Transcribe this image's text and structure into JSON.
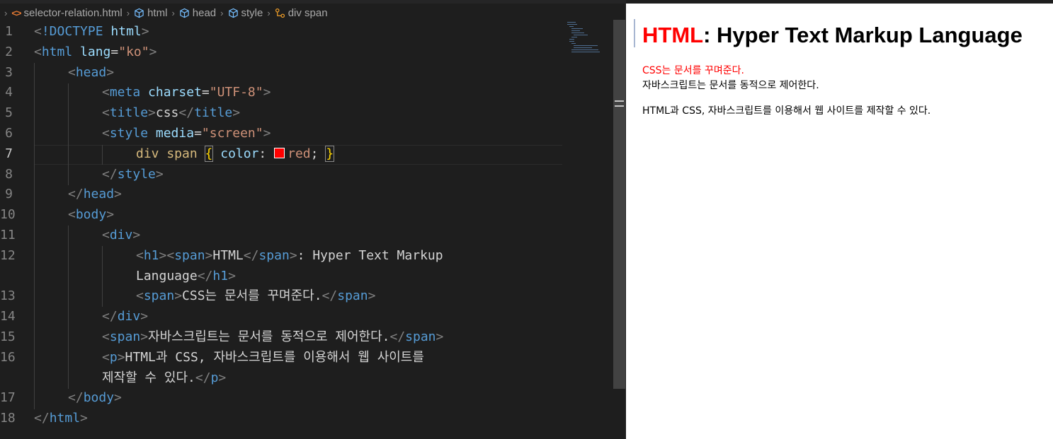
{
  "breadcrumb": {
    "file": "selector-relation.html",
    "items": [
      "html",
      "head",
      "style",
      "div span"
    ]
  },
  "gutter": [
    "1",
    "2",
    "3",
    "4",
    "5",
    "6",
    "7",
    "8",
    "9",
    "10",
    "11",
    "12",
    "13",
    "14",
    "15",
    "16",
    "17",
    "18"
  ],
  "code": {
    "l1_doctype": "!DOCTYPE",
    "l1_html": "html",
    "l2_tag": "html",
    "l2_attr": "lang",
    "l2_val": "\"ko\"",
    "l3_tag": "head",
    "l4_tag": "meta",
    "l4_attr": "charset",
    "l4_val": "\"UTF-8\"",
    "l5_tag": "title",
    "l5_text": "css",
    "l6_tag": "style",
    "l6_attr": "media",
    "l6_val": "\"screen\"",
    "l7_selector": "div span",
    "l7_prop": "color",
    "l7_value": "red",
    "l8_tag": "style",
    "l9_tag": "head",
    "l10_tag": "body",
    "l11_tag": "div",
    "l12_h1": "h1",
    "l12_span": "span",
    "l12_text1": "HTML",
    "l12_text2": ": Hyper Text Markup",
    "l12b_text": "Language",
    "l13_span": "span",
    "l13_text": "CSS는 문서를 꾸며준다.",
    "l14_tag": "div",
    "l15_span": "span",
    "l15_text": "자바스크립트는 문서를 동적으로 제어한다.",
    "l16_p": "p",
    "l16_text": "HTML과 CSS, 자바스크립트를 이용해서 웹 사이트를",
    "l16b_text": "제작할 수 있다.",
    "l17_tag": "body",
    "l18_tag": "html"
  },
  "preview": {
    "h1_red": "HTML",
    "h1_rest": ": Hyper Text Markup Language",
    "line1": "CSS는 문서를 꾸며준다.",
    "line2": "자바스크립트는 문서를 동적으로 제어한다.",
    "paragraph": "HTML과 CSS, 자바스크립트를 이용해서 웹 사이트를 제작할 수 있다."
  },
  "colors": {
    "editor_bg": "#1e1e1e",
    "tag": "#569cd6",
    "attribute": "#9cdcfe",
    "string": "#ce9178",
    "selector": "#d7ba7d",
    "preview_accent": "#ff0000"
  }
}
